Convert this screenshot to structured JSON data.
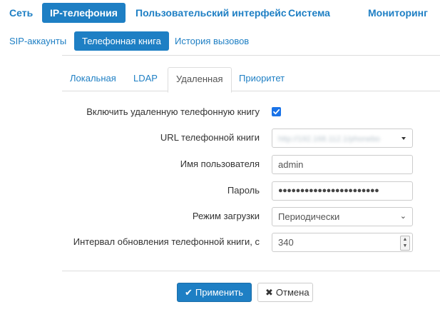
{
  "topnav": {
    "items": [
      {
        "label": "Сеть"
      },
      {
        "label": "IP-телефония"
      },
      {
        "label": "Пользовательский интерфейс"
      },
      {
        "label": "Система"
      },
      {
        "label": "Мониторинг"
      }
    ],
    "active_index": 1
  },
  "subnav": {
    "items": [
      {
        "label": "SIP-аккаунты"
      },
      {
        "label": "Телефонная книга"
      },
      {
        "label": "История вызовов"
      }
    ],
    "active_index": 1
  },
  "tabs": {
    "items": [
      {
        "label": "Локальная"
      },
      {
        "label": "LDAP"
      },
      {
        "label": "Удаленная"
      },
      {
        "label": "Приоритет"
      }
    ],
    "active_index": 2
  },
  "form": {
    "enable_remote": {
      "label": "Включить удаленную телефонную книгу",
      "checked": true
    },
    "url": {
      "label": "URL телефонной книги",
      "value": "http://192.168.112.1/phonebo"
    },
    "username": {
      "label": "Имя пользователя",
      "value": "admin"
    },
    "password": {
      "label": "Пароль",
      "value": "●●●●●●●●●●●●●●●●●●●●●●●"
    },
    "load_mode": {
      "label": "Режим загрузки",
      "value": "Периодически"
    },
    "interval": {
      "label": "Интервал обновления телефонной книги, с",
      "value": "340"
    }
  },
  "buttons": {
    "apply": {
      "label": "Применить",
      "icon": "check-icon"
    },
    "cancel": {
      "label": "Отмена",
      "icon": "close-icon"
    }
  },
  "colors": {
    "accent": "#1e7fc4",
    "checkbox": "#1a73e8"
  }
}
